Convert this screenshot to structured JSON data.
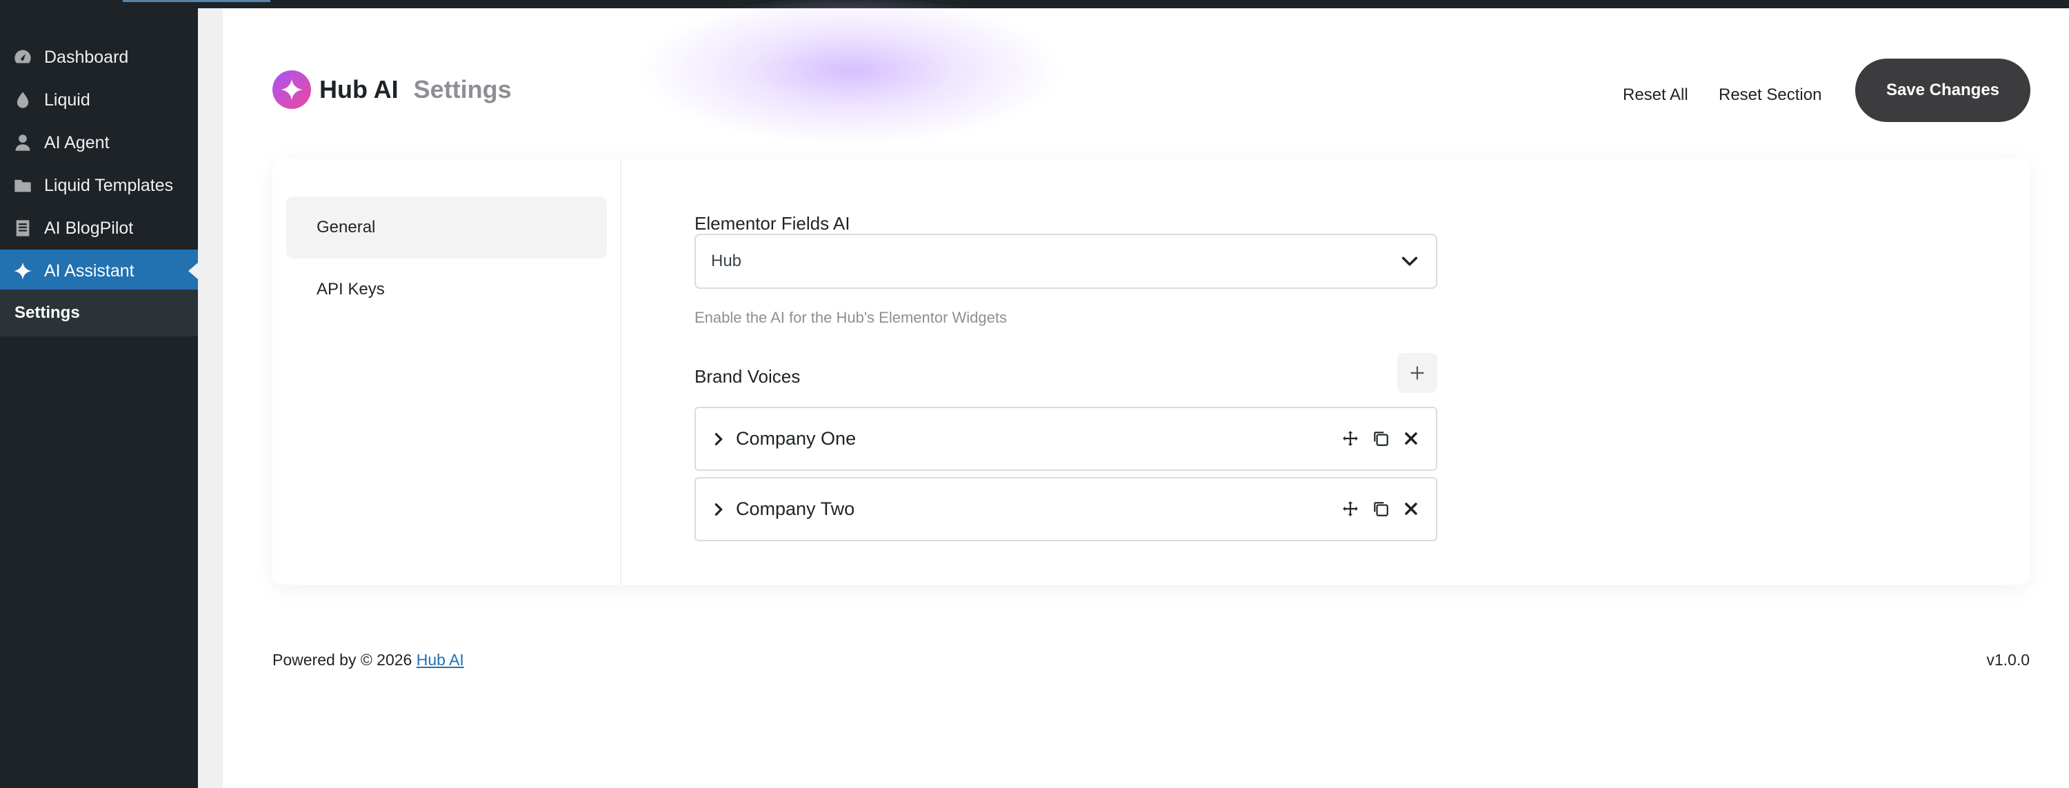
{
  "sidebar": {
    "items": [
      {
        "label": "Dashboard",
        "icon": "dashboard-icon"
      },
      {
        "label": "Liquid",
        "icon": "drop-icon"
      },
      {
        "label": "AI Agent",
        "icon": "user-icon"
      },
      {
        "label": "Liquid Templates",
        "icon": "folder-icon"
      },
      {
        "label": "AI BlogPilot",
        "icon": "document-icon"
      },
      {
        "label": "AI Assistant",
        "icon": "sparkle-icon",
        "active": true
      }
    ],
    "submenu": {
      "label": "Settings"
    }
  },
  "header": {
    "brand_name": "Hub AI",
    "page_title": "Settings",
    "reset_all_label": "Reset All",
    "reset_section_label": "Reset Section",
    "save_label": "Save Changes"
  },
  "settings_nav": [
    {
      "label": "General",
      "selected": true
    },
    {
      "label": "API Keys",
      "selected": false
    }
  ],
  "fields": {
    "elementor_fields_ai": {
      "label": "Elementor Fields AI",
      "value": "Hub",
      "help": "Enable the AI for the Hub's Elementor Widgets"
    },
    "brand_voices": {
      "label": "Brand Voices",
      "add_icon": "plus-icon",
      "items": [
        {
          "title": "Company One"
        },
        {
          "title": "Company Two"
        }
      ]
    }
  },
  "footer": {
    "powered_prefix": "Powered by © 2026 ",
    "powered_link": "Hub AI",
    "version": "v1.0.0"
  },
  "colors": {
    "admin_dark": "#1d2327",
    "active_blue": "#2271b1",
    "save_button": "#3c3c3f",
    "logo_gradient_start": "#a855f7",
    "logo_gradient_end": "#ec4899"
  }
}
